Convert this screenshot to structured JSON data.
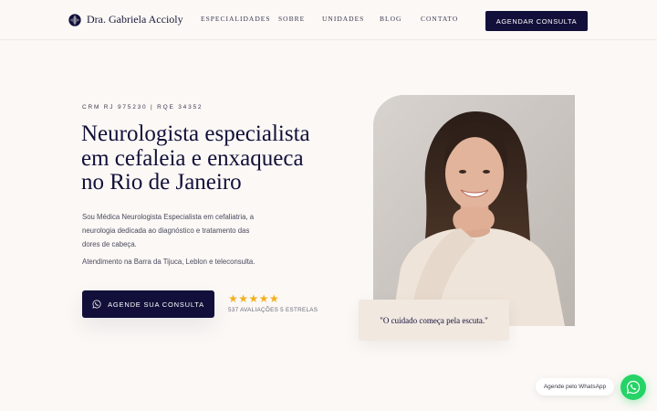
{
  "header": {
    "logo_text": "Dra. Gabriela Accioly",
    "nav": [
      "ESPECIALIDADES",
      "SOBRE",
      "UNIDADES",
      "BLOG",
      "CONTATO"
    ],
    "cta_label": "AGENDAR CONSULTA"
  },
  "hero": {
    "credentials": "CRM RJ 975230 | RQE 34352",
    "title_lines": [
      "Neurologista especialista",
      "em cefaleia e enxaqueca",
      "no Rio de Janeiro"
    ],
    "description": "Sou Médica Neurologista Especialista em cefaliatria, a neurologia dedicada ao diagnóstico e tratamento das dores de cabeça.",
    "location": "Atendimento na Barra da Tijuca, Leblon e teleconsulta.",
    "cta_label": "AGENDE SUA CONSULTA",
    "cta_icon": "whatsapp-icon",
    "rating": 5,
    "stars": "★★★★★",
    "reviews_text": "537 AVALIAÇÕES 5 ESTRELAS",
    "quote": "\"O cuidado começa pela escuta.\""
  },
  "whatsapp_widget": {
    "label": "Agende pelo WhatsApp",
    "icon": "whatsapp-icon"
  },
  "colors": {
    "background": "#fbf8f5",
    "navy": "#12103a",
    "star": "#f2b01e",
    "whatsapp": "#25d366",
    "quote_card": "#f1e8e0"
  }
}
